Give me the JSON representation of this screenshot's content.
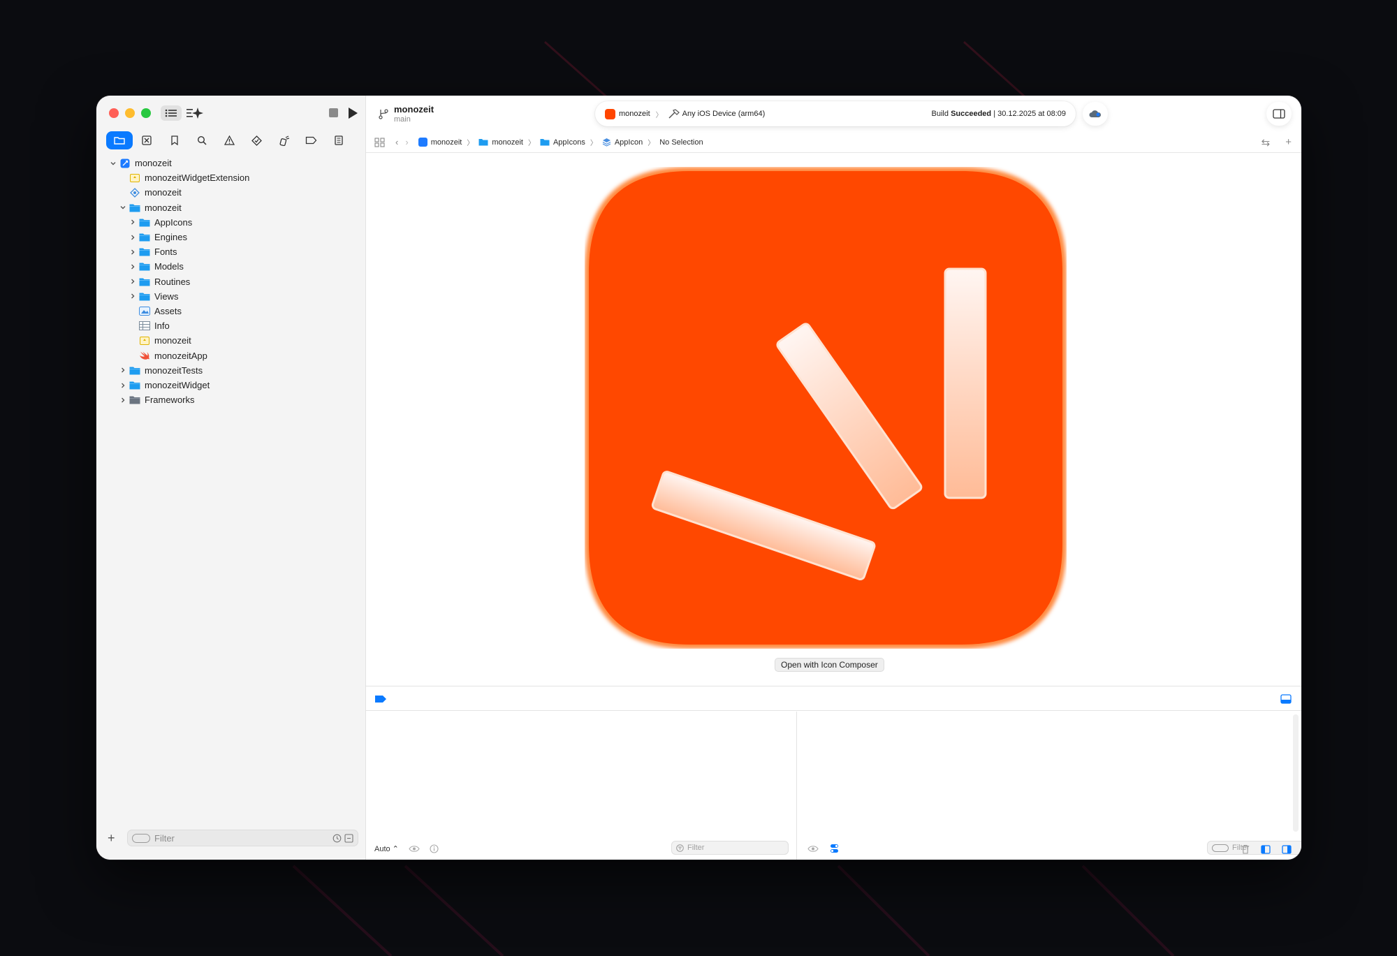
{
  "toolbar": {
    "project_name": "monozeit",
    "branch": "main",
    "scheme_name": "monozeit",
    "destination": "Any iOS Device (arm64)",
    "build_label": "Build",
    "build_result": "Succeeded",
    "build_time": "| 30.12.2025 at 08:09"
  },
  "jumpbar": {
    "crumbs": [
      "monozeit",
      "monozeit",
      "AppIcons",
      "AppIcon",
      "No Selection"
    ]
  },
  "navigator": {
    "items": [
      {
        "label": "monozeit",
        "depth": 0,
        "chevron": "open",
        "icon": "project-icon"
      },
      {
        "label": "monozeitWidgetExtension",
        "depth": 1,
        "chevron": "none",
        "icon": "entitlements-icon"
      },
      {
        "label": "monozeit",
        "depth": 1,
        "chevron": "none",
        "icon": "testplan-icon"
      },
      {
        "label": "monozeit",
        "depth": 1,
        "chevron": "open",
        "icon": "folder-icon"
      },
      {
        "label": "AppIcons",
        "depth": 2,
        "chevron": "closed",
        "icon": "folder-icon"
      },
      {
        "label": "Engines",
        "depth": 2,
        "chevron": "closed",
        "icon": "folder-icon"
      },
      {
        "label": "Fonts",
        "depth": 2,
        "chevron": "closed",
        "icon": "folder-icon"
      },
      {
        "label": "Models",
        "depth": 2,
        "chevron": "closed",
        "icon": "folder-icon"
      },
      {
        "label": "Routines",
        "depth": 2,
        "chevron": "closed",
        "icon": "folder-icon"
      },
      {
        "label": "Views",
        "depth": 2,
        "chevron": "closed",
        "icon": "folder-icon"
      },
      {
        "label": "Assets",
        "depth": 2,
        "chevron": "none",
        "icon": "assets-icon"
      },
      {
        "label": "Info",
        "depth": 2,
        "chevron": "none",
        "icon": "plist-icon"
      },
      {
        "label": "monozeit",
        "depth": 2,
        "chevron": "none",
        "icon": "entitlements-icon"
      },
      {
        "label": "monozeitApp",
        "depth": 2,
        "chevron": "none",
        "icon": "swift-file-icon"
      },
      {
        "label": "monozeitTests",
        "depth": 1,
        "chevron": "closed",
        "icon": "folder-icon"
      },
      {
        "label": "monozeitWidget",
        "depth": 1,
        "chevron": "closed",
        "icon": "folder-icon"
      },
      {
        "label": "Frameworks",
        "depth": 1,
        "chevron": "closed",
        "icon": "frameworks-icon"
      }
    ],
    "filter_placeholder": "Filter"
  },
  "editor": {
    "open_button": "Open with Icon Composer"
  },
  "debug": {
    "auto_label": "Auto ⌃",
    "filter_left": "Filter",
    "filter_right": "Filter"
  },
  "colors": {
    "accent": "#0a7aff",
    "icon_orange": "#ff4800",
    "folder_blue": "#1e9cf0"
  }
}
